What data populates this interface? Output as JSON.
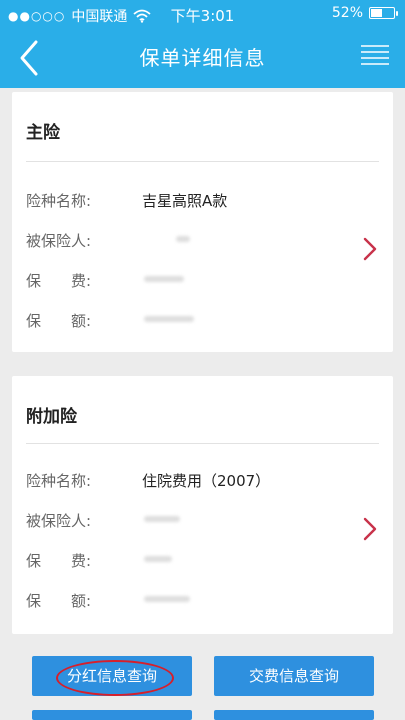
{
  "status_bar": {
    "signal_dots": "●●○○○",
    "carrier": "中国联通",
    "time": "下午3:01",
    "battery": "52%",
    "battery_level_percent": 52
  },
  "header": {
    "title": "保单详细信息"
  },
  "main_insurance": {
    "title": "主险",
    "rows": [
      {
        "label": "险种名称:",
        "value": "吉星高照A款"
      },
      {
        "label": "被保险人:",
        "value": ""
      },
      {
        "label": "保　　费:",
        "value": ""
      },
      {
        "label": "保　　额:",
        "value": ""
      }
    ]
  },
  "rider_insurance": {
    "title": "附加险",
    "rows": [
      {
        "label": "险种名称:",
        "value": "住院费用（2007）"
      },
      {
        "label": "被保险人:",
        "value": ""
      },
      {
        "label": "保　　费:",
        "value": ""
      },
      {
        "label": "保　　额:",
        "value": ""
      }
    ]
  },
  "buttons": {
    "dividend_query": "分红信息查询",
    "payment_query": "交费信息查询"
  },
  "colors": {
    "header_bg": "#2aaee8",
    "button_bg": "#2e90df",
    "chevron": "#c8324a",
    "annotation": "#d61f2b"
  },
  "icons": {
    "back": "chevron-left-icon",
    "menu": "menu-icon",
    "detail": "chevron-right-icon"
  }
}
